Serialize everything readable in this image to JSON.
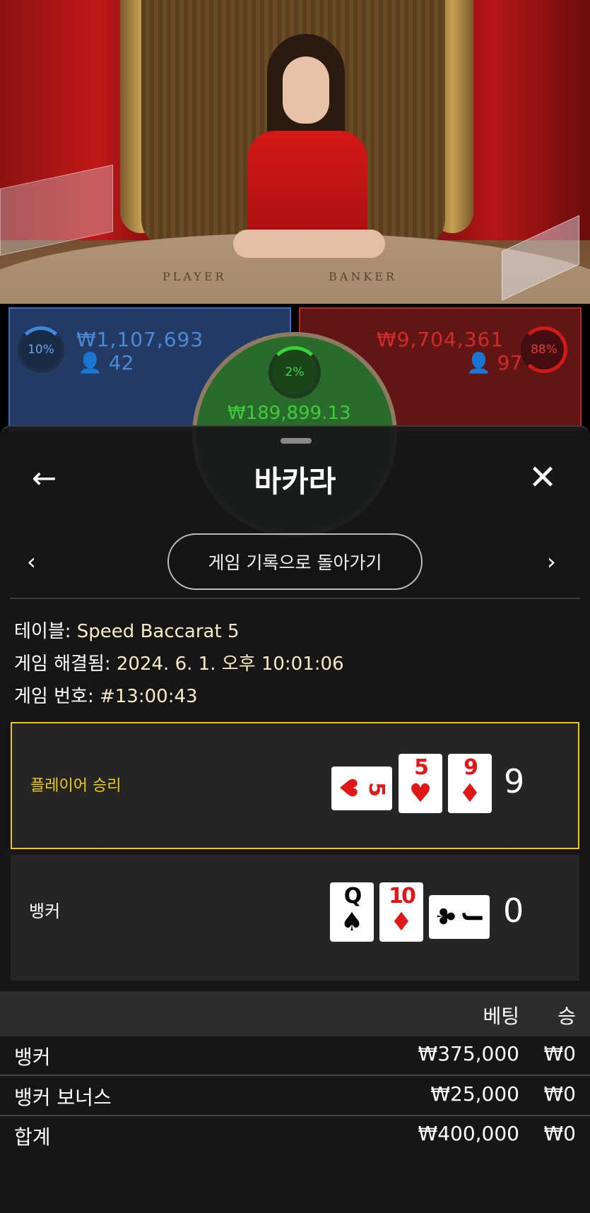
{
  "video": {
    "table_labels": [
      "PLAYER",
      "BANKER"
    ]
  },
  "bet_spots": {
    "player": {
      "percent": "10%",
      "amount": "₩1,107,693",
      "players": "42",
      "color": "#3a6ab8"
    },
    "tie": {
      "percent": "2%",
      "amount": "₩189,899.13",
      "color": "#2a6a2a"
    },
    "banker": {
      "percent": "88%",
      "amount": "₩9,704,361",
      "players": "97",
      "color": "#b82828"
    }
  },
  "modal": {
    "title": "바카라",
    "back_icon": "arrow-left-icon",
    "close_icon": "close-icon",
    "history_button": "게임 기록으로 돌아가기",
    "info": {
      "table_label": "테이블: ",
      "table_value": "Speed Baccarat 5",
      "resolved_label": "게임 해결됨: ",
      "resolved_value": "2024. 6. 1. 오후 10:01:06",
      "round_label": "게임 번호: ",
      "round_value": "#13:00:43"
    },
    "results": [
      {
        "label": "플레이어 승리",
        "winner": true,
        "highlight_color": "#e8c61a",
        "cards": [
          {
            "rank": "5",
            "suit": "♥",
            "color": "red",
            "orientation": "horizontal"
          },
          {
            "rank": "5",
            "suit": "♥",
            "color": "red",
            "orientation": "vertical"
          },
          {
            "rank": "9",
            "suit": "♦",
            "color": "red",
            "orientation": "vertical"
          }
        ],
        "score": "9"
      },
      {
        "label": "뱅커",
        "winner": false,
        "cards": [
          {
            "rank": "Q",
            "suit": "♠",
            "color": "black",
            "orientation": "vertical"
          },
          {
            "rank": "10",
            "suit": "♦",
            "color": "red",
            "orientation": "vertical"
          },
          {
            "rank": "J",
            "suit": "♣",
            "color": "black",
            "orientation": "horizontal"
          }
        ],
        "score": "0"
      }
    ],
    "bets_table": {
      "headers": {
        "bet": "베팅",
        "win": "승"
      },
      "rows": [
        {
          "label": "뱅커",
          "bet": "₩375,000",
          "win": "₩0"
        },
        {
          "label": "뱅커 보너스",
          "bet": "₩25,000",
          "win": "₩0"
        },
        {
          "label": "합계",
          "bet": "₩400,000",
          "win": "₩0"
        }
      ]
    }
  }
}
